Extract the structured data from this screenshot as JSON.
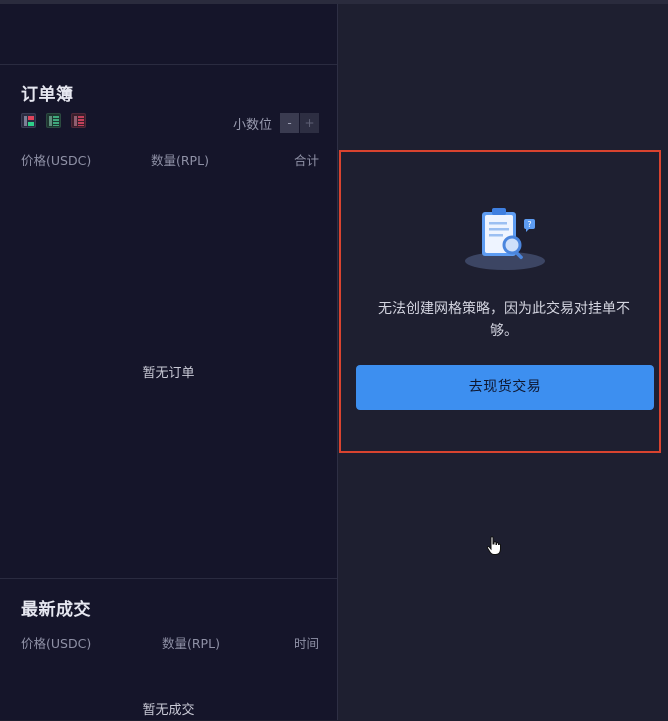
{
  "orderbook": {
    "title": "订单簿",
    "view_icons": [
      "orderbook-both-icon",
      "orderbook-buy-icon",
      "orderbook-sell-icon"
    ],
    "decimals_label": "小数位",
    "stepper_minus": "-",
    "stepper_plus": "+",
    "columns": [
      "价格(USDC)",
      "数量(RPL)",
      "合计"
    ],
    "empty": "暂无订单"
  },
  "trades": {
    "title": "最新成交",
    "columns": [
      "价格(USDC)",
      "数量(RPL)",
      "时间"
    ],
    "empty": "暂无成交"
  },
  "grid_notice": {
    "illustration": "clipboard-search-icon",
    "message": "无法创建网格策略，因为此交易对挂单不够。",
    "button_label": "去现货交易"
  },
  "colors": {
    "accent": "#3d8ff0",
    "highlight_border": "#d9432f",
    "buy": "#2ecf8a",
    "sell": "#e0445c"
  }
}
